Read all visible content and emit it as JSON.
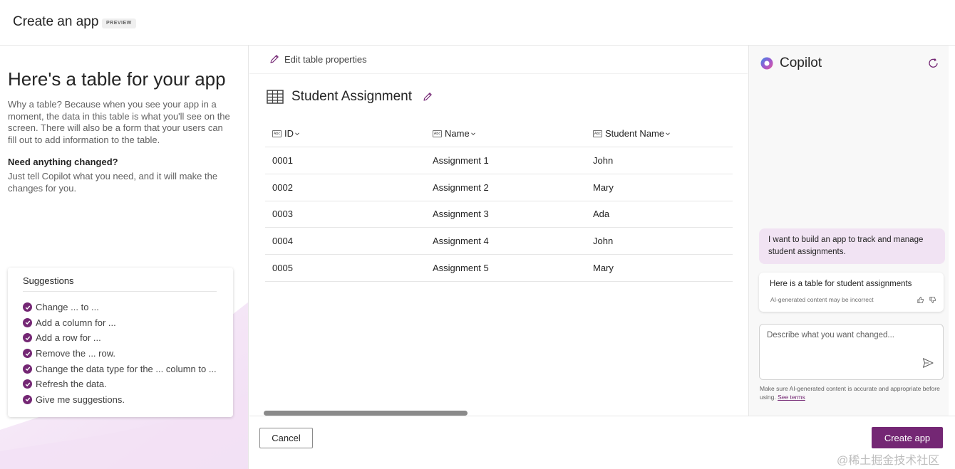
{
  "header": {
    "title": "Create an app",
    "badge": "PREVIEW"
  },
  "left": {
    "heading": "Here's a table for your app",
    "description": "Why a table? Because when you see your app in a moment, the data in this table is what you'll see on the screen. There will also be a form that your users can fill out to add information to the table.",
    "need_title": "Need anything changed?",
    "need_description": "Just tell Copilot what you need, and it will make the changes for you.",
    "suggestions": {
      "title": "Suggestions",
      "items": [
        "Change ... to ...",
        "Add a column for ...",
        "Add a row for ...",
        "Remove the ... row.",
        "Change the data type for the ... column to ...",
        "Refresh the data.",
        "Give me suggestions."
      ]
    }
  },
  "toolbar": {
    "edit_label": "Edit table properties"
  },
  "table": {
    "title": "Student Assignment",
    "columns": [
      "ID",
      "Name",
      "Student Name"
    ],
    "rows": [
      [
        "0001",
        "Assignment 1",
        "John"
      ],
      [
        "0002",
        "Assignment 2",
        "Mary"
      ],
      [
        "0003",
        "Assignment 3",
        "Ada"
      ],
      [
        "0004",
        "Assignment 4",
        "John"
      ],
      [
        "0005",
        "Assignment 5",
        "Mary"
      ]
    ]
  },
  "footer": {
    "cancel_label": "Cancel",
    "create_label": "Create app",
    "watermark": "@稀土掘金技术社区"
  },
  "copilot": {
    "title": "Copilot",
    "user_message": "I want to build an app to track and manage student assignments.",
    "bot_message": "Here is a table for student assignments",
    "bot_note": "AI-generated content may be incorrect",
    "input_placeholder": "Describe what you want changed...",
    "disclaimer_text": "Make sure AI-generated content is accurate and appropriate before using.",
    "disclaimer_link": "See terms"
  },
  "colors": {
    "accent": "#742774",
    "user_bubble": "#f1e3f3"
  }
}
